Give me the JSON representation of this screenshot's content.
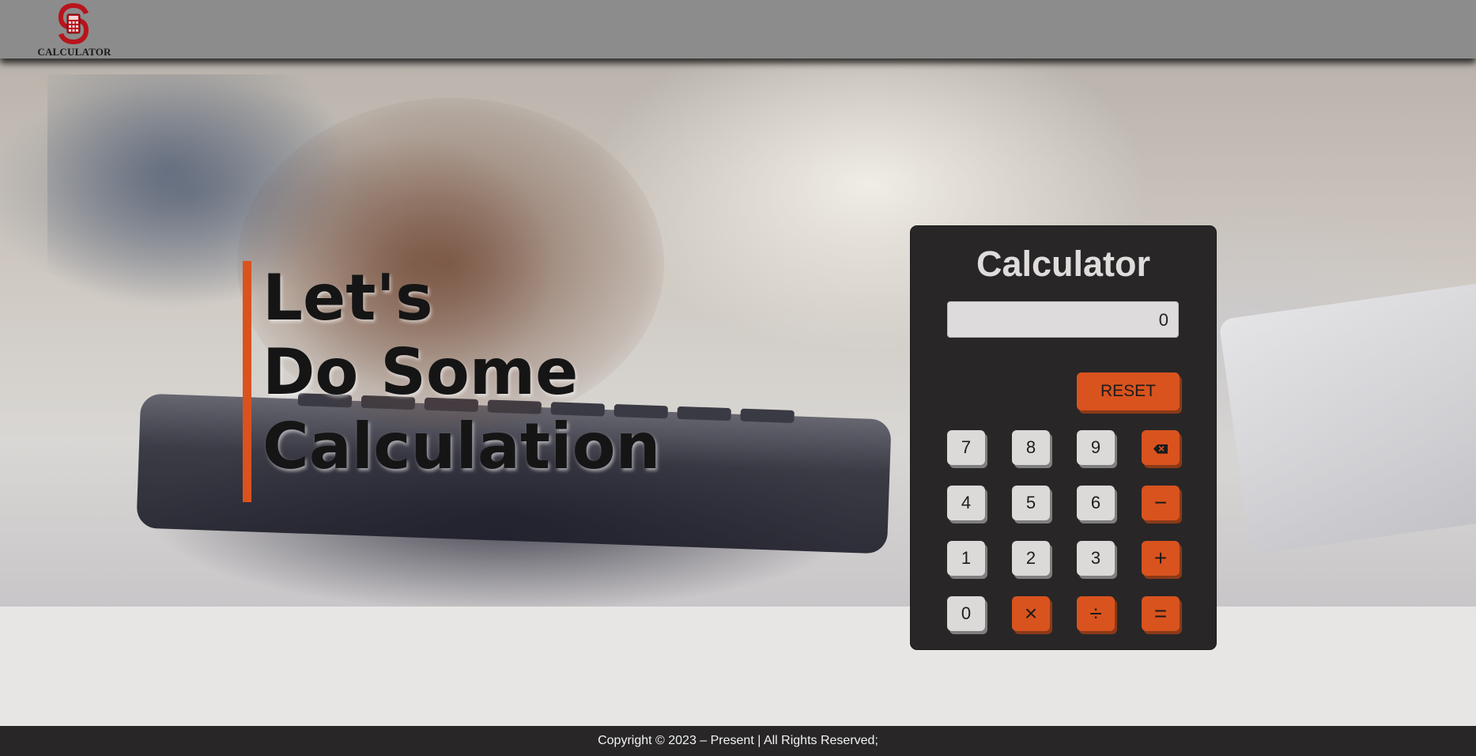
{
  "header": {
    "logo_text": "CALCULATOR"
  },
  "hero": {
    "title_lines": [
      "Let's",
      "Do Some",
      "Calculation"
    ]
  },
  "calculator": {
    "title": "Calculator",
    "display_value": "0",
    "reset_label": "RESET",
    "buttons": {
      "b7": "7",
      "b8": "8",
      "b9": "9",
      "backspace": "backspace-icon",
      "b4": "4",
      "b5": "5",
      "b6": "6",
      "minus": "−",
      "b1": "1",
      "b2": "2",
      "b3": "3",
      "plus": "+",
      "b0": "0",
      "multiply": "×",
      "divide": "÷",
      "equals": "="
    }
  },
  "footer": {
    "copyright": "Copyright © 2023 – Present | All Rights Reserved;"
  },
  "colors": {
    "accent": "#d9531e",
    "header_bg": "#8c8c8c",
    "card_bg": "#282627",
    "page_bg": "#e8e6e4"
  }
}
